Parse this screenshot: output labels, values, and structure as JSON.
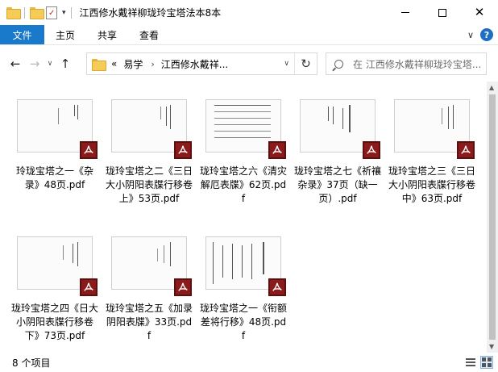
{
  "window": {
    "title": "江西修水戴祥柳珑玲宝塔法本8本",
    "quick_access_arrow": "▾"
  },
  "ribbon": {
    "tabs": [
      "文件",
      "主页",
      "共享",
      "查看"
    ],
    "expand_label": "∨",
    "help_label": "?"
  },
  "address_bar": {
    "overflow": "«",
    "segments": [
      "易学",
      "江西修水戴祥..."
    ],
    "separator": "›"
  },
  "search": {
    "placeholder": "在 江西修水戴祥柳珑玲宝塔..."
  },
  "files": [
    {
      "name": "玲珑宝塔之一《杂录》48页.pdf",
      "icon": "pdf-icon"
    },
    {
      "name": "珑玲宝塔之二《三日大小阴阳表牒行移卷上》53页.pdf",
      "icon": "pdf-icon"
    },
    {
      "name": "珑玲宝塔之六《清灾解厄表牒》62页.pdf",
      "icon": "pdf-icon"
    },
    {
      "name": "珑玲宝塔之七《祈禳杂录》37页（缺一页）.pdf",
      "icon": "pdf-icon"
    },
    {
      "name": "珑玲宝塔之三《三日大小阴阳表牒行移卷中》63页.pdf",
      "icon": "pdf-icon"
    },
    {
      "name": "珑玲宝塔之四《日大小阴阳表牒行移卷下》73页.pdf",
      "icon": "pdf-icon"
    },
    {
      "name": "珑玲宝塔之五《加录阴阳表牒》33页.pdf",
      "icon": "pdf-icon"
    },
    {
      "name": "珑玲宝塔之一《衔额差将行移》48页.pdf",
      "icon": "pdf-icon"
    }
  ],
  "status": {
    "item_count": "8 个项目"
  },
  "colors": {
    "file_tab": "#1979ca",
    "pdf_badge": "#8b1a1a",
    "folder": "#f6cc58"
  }
}
